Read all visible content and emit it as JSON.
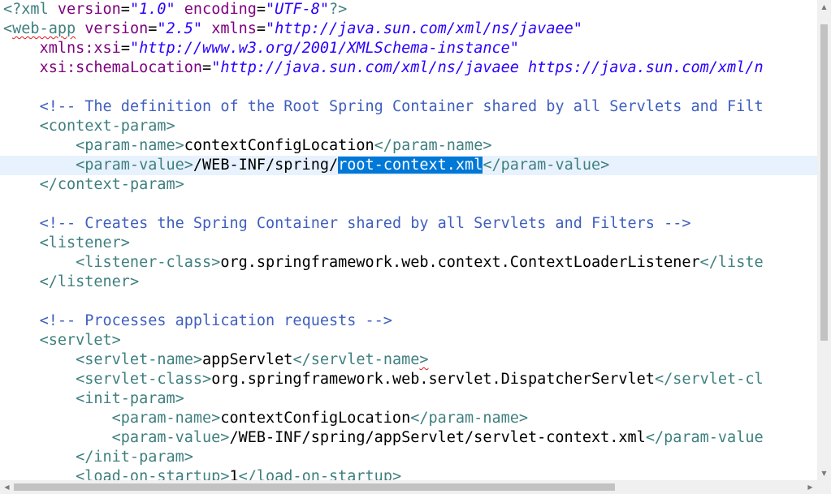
{
  "editor": {
    "lines": [
      {
        "cur": false,
        "tokens": [
          {
            "c": "pi",
            "t": "<?xml "
          },
          {
            "c": "attr",
            "t": "version"
          },
          {
            "c": "txt",
            "t": "="
          },
          {
            "c": "val",
            "t": "\"1.0\""
          },
          {
            "c": "txt",
            "t": " "
          },
          {
            "c": "attr",
            "t": "encoding"
          },
          {
            "c": "txt",
            "t": "="
          },
          {
            "c": "val",
            "t": "\"UTF-8\""
          },
          {
            "c": "pi",
            "t": "?>"
          }
        ]
      },
      {
        "cur": false,
        "tokens": [
          {
            "c": "tag",
            "t": "<"
          },
          {
            "c": "tag squig",
            "t": "web-app"
          },
          {
            "c": "txt",
            "t": " "
          },
          {
            "c": "attr",
            "t": "version"
          },
          {
            "c": "txt",
            "t": "="
          },
          {
            "c": "val",
            "t": "\"2.5\""
          },
          {
            "c": "txt",
            "t": " "
          },
          {
            "c": "attr",
            "t": "xmlns"
          },
          {
            "c": "txt",
            "t": "="
          },
          {
            "c": "val",
            "t": "\"http://java.sun.com/xml/ns/javaee\""
          }
        ]
      },
      {
        "cur": false,
        "tokens": [
          {
            "c": "txt",
            "t": "    "
          },
          {
            "c": "attr",
            "t": "xmlns:xsi"
          },
          {
            "c": "txt",
            "t": "="
          },
          {
            "c": "val",
            "t": "\"http://www.w3.org/2001/XMLSchema-instance\""
          }
        ]
      },
      {
        "cur": false,
        "tokens": [
          {
            "c": "txt",
            "t": "    "
          },
          {
            "c": "attr",
            "t": "xsi:schemaLocation"
          },
          {
            "c": "txt",
            "t": "="
          },
          {
            "c": "val",
            "t": "\"http://java.sun.com/xml/ns/javaee https://java.sun.com/xml/n"
          }
        ]
      },
      {
        "cur": false,
        "tokens": []
      },
      {
        "cur": false,
        "tokens": [
          {
            "c": "txt",
            "t": "    "
          },
          {
            "c": "cmt",
            "t": "<!-- The definition of the Root Spring Container shared by all Servlets and Filt"
          }
        ]
      },
      {
        "cur": false,
        "tokens": [
          {
            "c": "txt",
            "t": "    "
          },
          {
            "c": "tag",
            "t": "<context-param>"
          }
        ]
      },
      {
        "cur": false,
        "tokens": [
          {
            "c": "txt",
            "t": "        "
          },
          {
            "c": "tag",
            "t": "<param-name>"
          },
          {
            "c": "txt",
            "t": "contextConfigLocation"
          },
          {
            "c": "tag",
            "t": "</param-name>"
          }
        ]
      },
      {
        "cur": true,
        "tokens": [
          {
            "c": "txt",
            "t": "        "
          },
          {
            "c": "tag",
            "t": "<param-value>"
          },
          {
            "c": "txt",
            "t": "/WEB-INF/spring/"
          },
          {
            "c": "sel",
            "t": "root-context.xml"
          },
          {
            "c": "tag",
            "t": "</param-value>"
          }
        ]
      },
      {
        "cur": false,
        "tokens": [
          {
            "c": "txt",
            "t": "    "
          },
          {
            "c": "tag",
            "t": "</context-param>"
          }
        ]
      },
      {
        "cur": false,
        "tokens": []
      },
      {
        "cur": false,
        "tokens": [
          {
            "c": "txt",
            "t": "    "
          },
          {
            "c": "cmt",
            "t": "<!-- Creates the Spring Container shared by all Servlets and Filters -->"
          }
        ]
      },
      {
        "cur": false,
        "tokens": [
          {
            "c": "txt",
            "t": "    "
          },
          {
            "c": "tag",
            "t": "<listener>"
          }
        ]
      },
      {
        "cur": false,
        "tokens": [
          {
            "c": "txt",
            "t": "        "
          },
          {
            "c": "tag",
            "t": "<listener-class>"
          },
          {
            "c": "txt",
            "t": "org.springframework.web.context.ContextLoaderListener"
          },
          {
            "c": "tag",
            "t": "</liste"
          }
        ]
      },
      {
        "cur": false,
        "tokens": [
          {
            "c": "txt",
            "t": "    "
          },
          {
            "c": "tag",
            "t": "</listener>"
          }
        ]
      },
      {
        "cur": false,
        "tokens": []
      },
      {
        "cur": false,
        "tokens": [
          {
            "c": "txt",
            "t": "    "
          },
          {
            "c": "cmt",
            "t": "<!-- Processes application requests -->"
          }
        ]
      },
      {
        "cur": false,
        "tokens": [
          {
            "c": "txt",
            "t": "    "
          },
          {
            "c": "tag",
            "t": "<servlet>"
          }
        ]
      },
      {
        "cur": false,
        "tokens": [
          {
            "c": "txt",
            "t": "        "
          },
          {
            "c": "tag",
            "t": "<servlet-name>"
          },
          {
            "c": "txt",
            "t": "appServlet"
          },
          {
            "c": "tag",
            "t": "</servlet-name"
          },
          {
            "c": "tag squig",
            "t": ">"
          }
        ]
      },
      {
        "cur": false,
        "tokens": [
          {
            "c": "txt",
            "t": "        "
          },
          {
            "c": "tag",
            "t": "<servlet-class>"
          },
          {
            "c": "txt",
            "t": "org.springframework.web.servlet.DispatcherServlet"
          },
          {
            "c": "tag",
            "t": "</servlet-cl"
          }
        ]
      },
      {
        "cur": false,
        "tokens": [
          {
            "c": "txt",
            "t": "        "
          },
          {
            "c": "tag",
            "t": "<init-param>"
          }
        ]
      },
      {
        "cur": false,
        "tokens": [
          {
            "c": "txt",
            "t": "            "
          },
          {
            "c": "tag",
            "t": "<param-name>"
          },
          {
            "c": "txt",
            "t": "contextConfigLocation"
          },
          {
            "c": "tag",
            "t": "</param-name>"
          }
        ]
      },
      {
        "cur": false,
        "tokens": [
          {
            "c": "txt",
            "t": "            "
          },
          {
            "c": "tag",
            "t": "<param-value>"
          },
          {
            "c": "txt",
            "t": "/WEB-INF/spring/appServlet/servlet-context.xml"
          },
          {
            "c": "tag",
            "t": "</param-value"
          }
        ]
      },
      {
        "cur": false,
        "tokens": [
          {
            "c": "txt",
            "t": "        "
          },
          {
            "c": "tag",
            "t": "</init-param>"
          }
        ]
      },
      {
        "cur": false,
        "tokens": [
          {
            "c": "txt",
            "t": "        "
          },
          {
            "c": "tag",
            "t": "<load-on-startup>"
          },
          {
            "c": "txt",
            "t": "1"
          },
          {
            "c": "tag",
            "t": "</load-on-startup>"
          }
        ]
      }
    ]
  },
  "scrollbars": {
    "up_arrow": "▲",
    "down_arrow": "▼",
    "left_arrow": "◀",
    "right_arrow": "▶"
  }
}
